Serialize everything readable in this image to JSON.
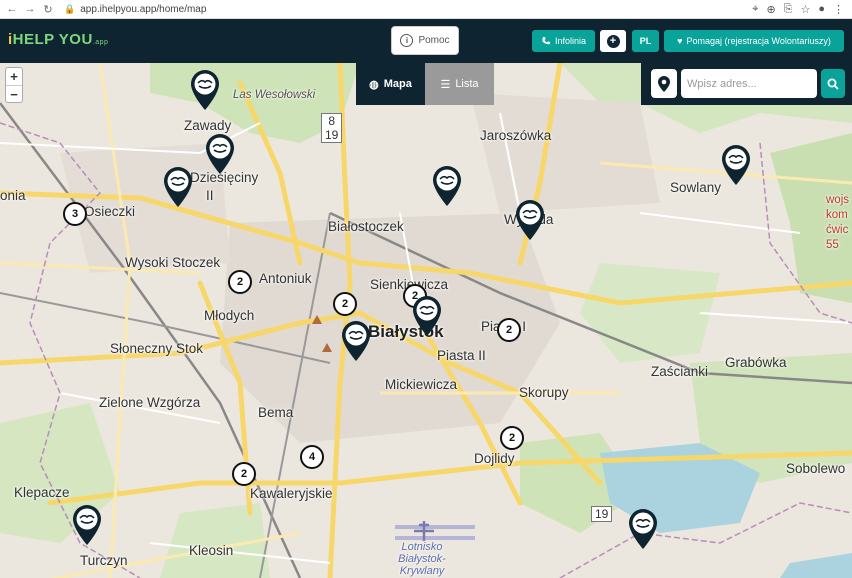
{
  "browser": {
    "url": "app.ihelpyou.app/home/map"
  },
  "header": {
    "logo": {
      "i": "i",
      "text": "HELP YOU",
      "suffix": ".app"
    },
    "pomoc_label": "Pomoc",
    "infolinia_label": "Infolinia",
    "lang_label": "PL",
    "volunteer_label": "Pomagaj (rejestracja Wolontariuszy)"
  },
  "view_tabs": {
    "map_label": "Mapa",
    "list_label": "Lista",
    "active": "Mapa"
  },
  "search": {
    "placeholder": "Wpisz adres..."
  },
  "zoom": {
    "in": "+",
    "out": "−"
  },
  "map_labels": {
    "las": "Las Wesołowski",
    "zawady": "Zawady",
    "dziesieciny": "Dziesięciny",
    "dziesieciny2": "II",
    "onia": "onia",
    "osiedle": "Osieczki",
    "bialostoczek": "Białostoczek",
    "jaroszowka": "Jaroszówka",
    "sowlany": "Sowlany",
    "wygoda": "Wygoda",
    "wysoki": "Wysoki Stoczek",
    "antoniuk": "Antoniuk",
    "sienkiewicza": "Sienkiewicza",
    "bialystok": "Białystok",
    "mlodych": "Młodych",
    "piasta1": "Piasta I",
    "piasta2": "Piasta II",
    "slonecznystok": "Słoneczny Stok",
    "mickiewicza": "Mickiewicza",
    "skorupy": "Skorupy",
    "grabowka": "Grabówka",
    "zascianki": "Zaścianki",
    "zielone": "Zielone Wzgórza",
    "bema": "Bema",
    "dojlidy": "Dojlidy",
    "klepacze": "Klepacze",
    "kawaleryjskie": "Kawaleryjskie",
    "sobolewo": "Sobolewo",
    "kleosin": "Kleosin",
    "turczyn": "Turczyn",
    "lotnisko": "Lotnisko Białystok-Krywlany",
    "wojs": "wojs\nkom\nćwic\n55"
  },
  "road_numbers": {
    "r8": "8",
    "r19a": "19",
    "r19b": "19"
  },
  "clusters": [
    "3",
    "2",
    "2",
    "2",
    "2",
    "2",
    "2",
    "2",
    "4"
  ],
  "colors": {
    "header_bg": "#0e2430",
    "accent": "#0aa39a",
    "marker": "#0e2430"
  }
}
